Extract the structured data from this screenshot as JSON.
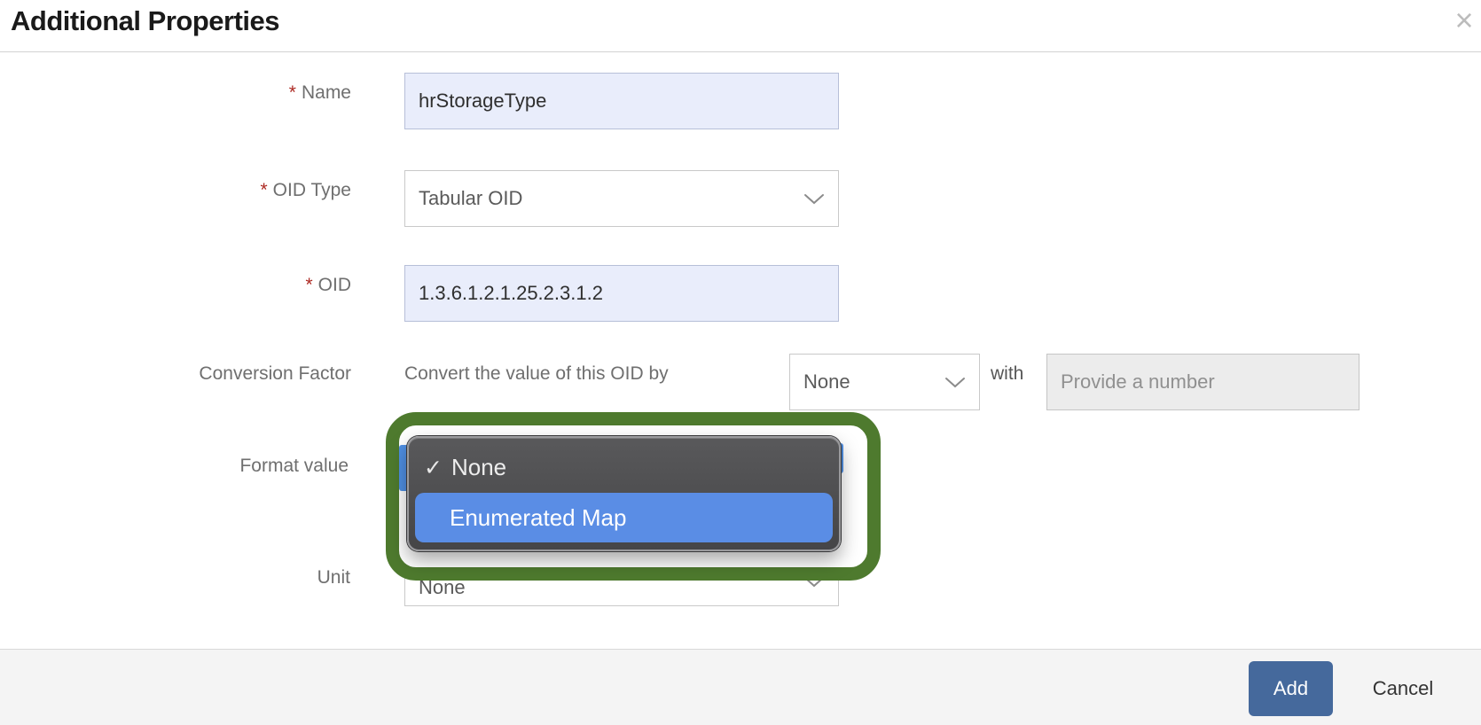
{
  "modal": {
    "title": "Additional Properties",
    "close_glyph": "×"
  },
  "form": {
    "required_marker": "*",
    "name": {
      "label": "Name",
      "value": "hrStorageType"
    },
    "oid_type": {
      "label": "OID Type",
      "value": "Tabular OID"
    },
    "oid": {
      "label": "OID",
      "value": "1.3.6.1.2.1.25.2.3.1.2"
    },
    "conversion_factor": {
      "label": "Conversion Factor",
      "helper_text": "Convert the value of this OID by",
      "operation_value": "None",
      "with_label": "with",
      "number_placeholder": "Provide a number"
    },
    "format_value": {
      "label": "Format value",
      "check_glyph": "✓",
      "options": [
        {
          "label": "None",
          "checked": true,
          "highlighted": false
        },
        {
          "label": "Enumerated Map",
          "checked": false,
          "highlighted": true
        }
      ]
    },
    "unit": {
      "label": "Unit",
      "value": "None"
    }
  },
  "footer": {
    "add_label": "Add",
    "cancel_label": "Cancel"
  },
  "colors": {
    "accent_button": "#45699c",
    "highlight_option": "#5a8de5",
    "annotation_green": "#4e7a2e",
    "filled_input_bg": "#e9edfb",
    "disabled_input_bg": "#ececec"
  }
}
